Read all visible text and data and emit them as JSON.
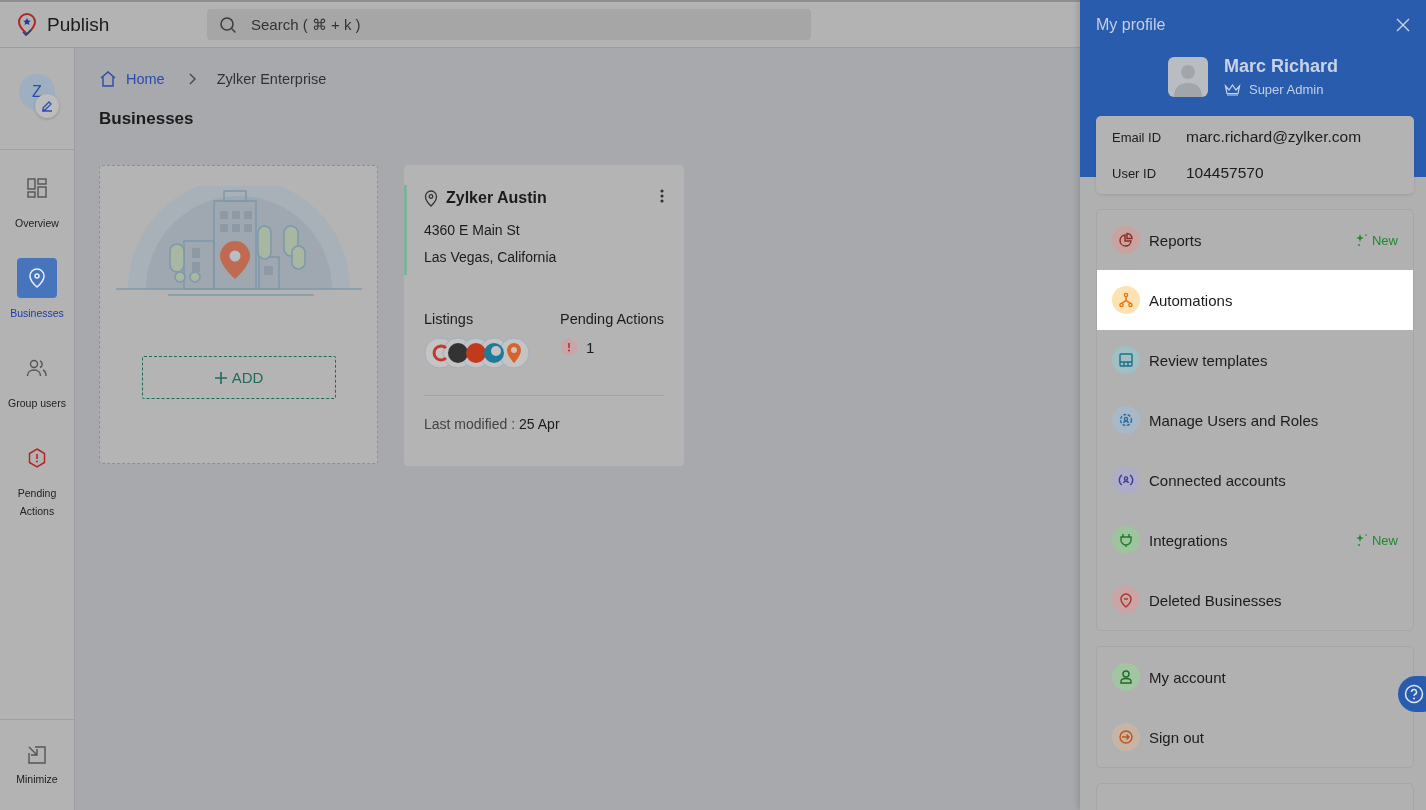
{
  "app": {
    "name": "Publish"
  },
  "search": {
    "placeholder": "Search ( ⌘ + k )"
  },
  "sidebar": {
    "avatar": "Z",
    "items": [
      {
        "label": "Overview",
        "kind": "overview",
        "selected": false
      },
      {
        "label": "Businesses",
        "kind": "businesses",
        "selected": true
      },
      {
        "label": "Group users",
        "kind": "users",
        "selected": false
      },
      {
        "label": "Pending Actions",
        "kind": "pending",
        "selected": false
      }
    ],
    "minimize": "Minimize"
  },
  "breadcrumb": [
    {
      "label": "Home",
      "kind": "home"
    },
    {
      "label": "Zylker Enterprise",
      "kind": "current"
    }
  ],
  "page_title": "Businesses",
  "add_button": "ADD",
  "business": {
    "name": "Zylker Austin",
    "address_lines": [
      "4360 E Main St",
      "Las Vegas, California"
    ],
    "listings_label": "Listings",
    "pending_label": "Pending Actions",
    "pending_count": "1",
    "modified_label": "Last modified :",
    "modified_value": "25 Apr"
  },
  "profile": {
    "title": "My profile",
    "name": "Marc Richard",
    "role": "Super Admin",
    "fields": [
      {
        "label": "Email ID",
        "value": "marc.richard@zylker.com"
      },
      {
        "label": "User ID",
        "value": "104457570"
      }
    ],
    "menu": [
      {
        "label": "Reports",
        "kind": "reports",
        "badge": "New",
        "selected": false
      },
      {
        "label": "Automations",
        "kind": "automations",
        "selected": true
      },
      {
        "label": "Review templates",
        "kind": "templates",
        "selected": false
      },
      {
        "label": "Manage Users and Roles",
        "kind": "roles",
        "selected": false
      },
      {
        "label": "Connected accounts",
        "kind": "connected",
        "selected": false
      },
      {
        "label": "Integrations",
        "kind": "integrations",
        "badge": "New",
        "selected": false
      },
      {
        "label": "Deleted Businesses",
        "kind": "deleted",
        "selected": false
      }
    ],
    "account_menu": [
      {
        "label": "My account",
        "kind": "account",
        "selected": false
      },
      {
        "label": "Sign out",
        "kind": "signout",
        "selected": false
      }
    ]
  }
}
